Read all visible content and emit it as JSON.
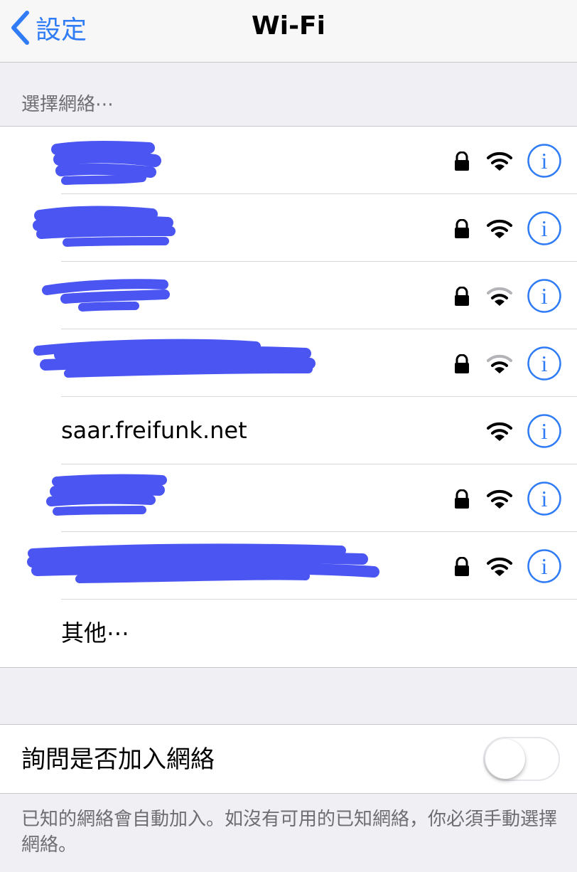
{
  "nav": {
    "back_label": "設定",
    "title": "Wi-Fi"
  },
  "section": {
    "choose_network_header": "選擇網絡⋯"
  },
  "networks": [
    {
      "name": "",
      "redacted": true,
      "secured": true,
      "signal": "full"
    },
    {
      "name": "",
      "redacted": true,
      "secured": true,
      "signal": "full"
    },
    {
      "name": "",
      "redacted": true,
      "secured": true,
      "signal": "weak"
    },
    {
      "name": "",
      "redacted": true,
      "secured": true,
      "signal": "weak"
    },
    {
      "name": "saar.freifunk.net",
      "redacted": false,
      "secured": false,
      "signal": "full"
    },
    {
      "name": "",
      "redacted": true,
      "secured": true,
      "signal": "full"
    },
    {
      "name": "",
      "redacted": true,
      "secured": true,
      "signal": "full"
    }
  ],
  "other": {
    "label": "其他⋯"
  },
  "ask_to_join": {
    "label": "詢問是否加入網絡",
    "enabled": false
  },
  "footer": {
    "text": "已知的網絡會自動加入。如沒有可用的已知網絡，你必須手動選擇網絡。"
  },
  "colors": {
    "accent": "#2f7cf6",
    "redaction": "#4a55f2",
    "weak_signal": "#b4b4b8",
    "lock": "#000000"
  },
  "icons": {
    "back": "chevron-left-icon",
    "lock": "lock-icon",
    "wifi": "wifi-icon",
    "info": "info-icon"
  }
}
